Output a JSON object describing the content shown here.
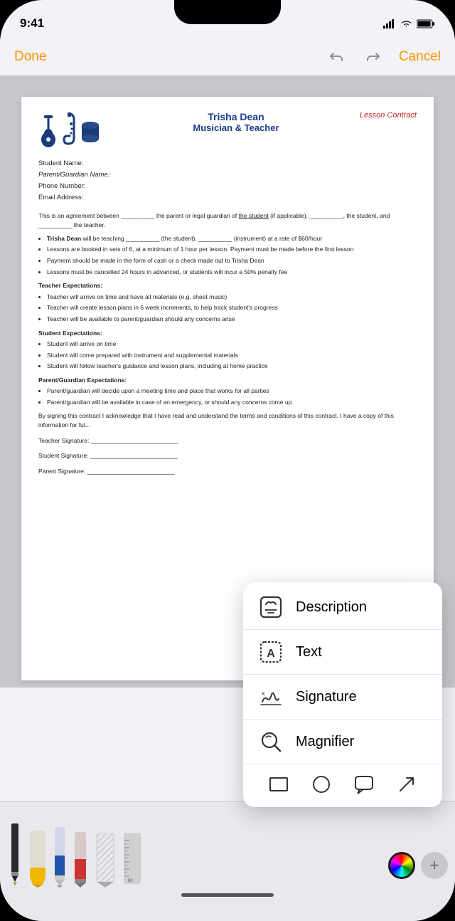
{
  "status_bar": {
    "time": "9:41",
    "signal_icon": "signal-icon",
    "wifi_icon": "wifi-icon",
    "battery_icon": "battery-icon"
  },
  "nav": {
    "done_label": "Done",
    "cancel_label": "Cancel",
    "undo_icon": "undo-icon",
    "redo_icon": "redo-icon"
  },
  "document": {
    "header": {
      "name": "Trisha Dean",
      "title": "Musician & Teacher",
      "label": "Lesson Contract"
    },
    "fields": {
      "student_name": "Student Name:",
      "guardian_name": "Parent/Guardian Name:",
      "phone": "Phone Number:",
      "email": "Email Address:"
    },
    "body_intro": "This is an agreement between __________ the parent or legal guardian of the student (if applicable), __________, the student, and __________ the teacher.",
    "bullet_points": [
      "Trisha Dean will be teaching __________ (the student), __________ (instrument) at a rate of $60/hour",
      "Lessons are booked in sets of 6, at a minimum of 1 hour per lesson. Payment must be made before the first lesson",
      "Payment should be made in the form of cash or a check made out to Trisha Dean",
      "Lessons must be cancelled 24 hours in advanced, or students will incur a 50% penalty fee"
    ],
    "teacher_expectations_title": "Teacher Expectations:",
    "teacher_expectations": [
      "Teacher will arrive on time and have all materials (e.g. sheet music)",
      "Teacher will create lesson plans in 6 week increments, to help track student's progress",
      "Teacher will be available to parent/guardian should any concerns arise"
    ],
    "student_expectations_title": "Student Expectations:",
    "student_expectations": [
      "Student will arrive on time",
      "Student will come prepared with instrument and supplemental materials",
      "Student will follow teacher's guidance and lesson plans, including at home practice"
    ],
    "parent_expectations_title": "Parent/Guardian Expectations:",
    "parent_expectations": [
      "Parent/guardian will decide upon a meeting time and place that works for all parties",
      "Parent/guardian will be available in case of an emergency, or should any concerns come up"
    ],
    "closing": "By signing this contract I acknowledge that I have read and understand the terms and conditions of this contract. I have a copy of this information for fut...",
    "signatures": {
      "teacher": "Teacher Signature: __________________________",
      "student": "Student Signature: __________________________",
      "parent": "Parent Signature: __________________________"
    }
  },
  "popup_menu": {
    "items": [
      {
        "id": "description",
        "label": "Description",
        "icon": "description-icon"
      },
      {
        "id": "text",
        "label": "Text",
        "icon": "text-icon"
      },
      {
        "id": "signature",
        "label": "Signature",
        "icon": "signature-icon"
      },
      {
        "id": "magnifier",
        "label": "Magnifier",
        "icon": "magnifier-icon"
      }
    ],
    "shapes": [
      {
        "id": "rectangle",
        "icon": "rectangle-icon"
      },
      {
        "id": "circle",
        "icon": "circle-icon"
      },
      {
        "id": "speech-bubble",
        "icon": "speech-bubble-icon"
      },
      {
        "id": "arrow",
        "icon": "arrow-icon"
      }
    ]
  },
  "toolbar": {
    "tools": [
      "pencil",
      "highlighter-yellow",
      "pen-blue",
      "eraser-red",
      "texture",
      "ruler"
    ],
    "color_label": "color-wheel",
    "add_label": "+"
  }
}
